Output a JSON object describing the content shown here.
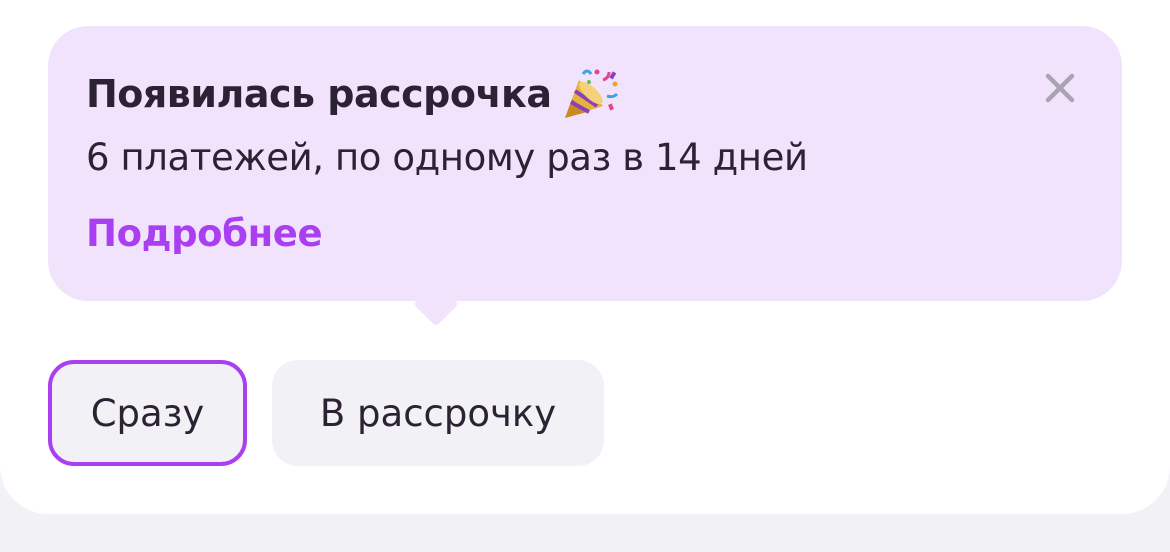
{
  "tooltip": {
    "title": "Появилась рассрочка",
    "title_icon": "party-popper-icon",
    "subtitle": "6 платежей, по одному раз в 14 дней",
    "link": "Подробнее",
    "close_icon": "close-icon"
  },
  "payment_options": {
    "selected": "Сразу",
    "options": [
      "Сразу",
      "В рассрочку"
    ]
  },
  "colors": {
    "accent": "#a93ff0",
    "tooltip_bg": "#f1e3fc",
    "text": "#2b2333",
    "chip_bg": "#f2f1f6"
  }
}
